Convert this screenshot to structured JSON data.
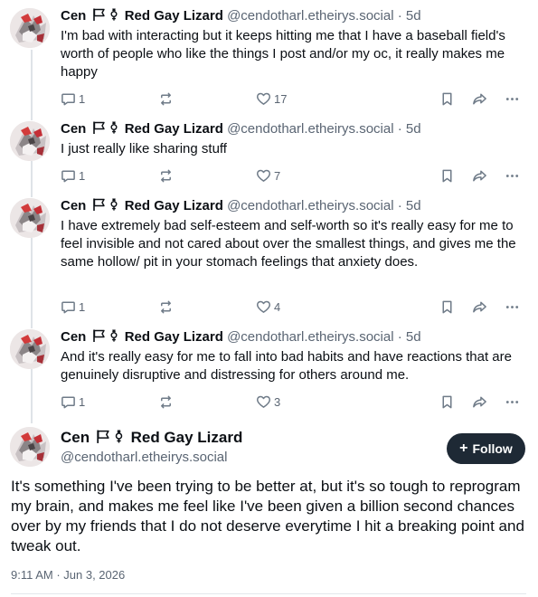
{
  "author": {
    "name": "Cen",
    "name_suffix": "Red Gay Lizard",
    "handle": "@cendotharl.etheirys.social"
  },
  "icons": {
    "flag": "flag-icon",
    "gender": "genderqueer-symbol-icon",
    "reply": "reply-icon",
    "repost": "repost-icon",
    "like": "heart-icon",
    "bookmark": "bookmark-icon",
    "share": "share-icon",
    "more": "more-icon"
  },
  "posts": [
    {
      "time": "5d",
      "text": "I'm bad with interacting but it keeps hitting me that I have a baseball field's worth of people who like the things I post and/or my oc, it really makes me happy",
      "replies": "1",
      "likes": "17"
    },
    {
      "time": "5d",
      "text": "I just really like sharing stuff",
      "replies": "1",
      "likes": "7"
    },
    {
      "time": "5d",
      "text": "I have extremely bad self-esteem and self-worth so it's really easy for me to feel invisible and not cared about over the smallest things, and gives me the same hollow/ pit in your stomach feelings that anxiety does.",
      "replies": "1",
      "likes": "4"
    },
    {
      "time": "5d",
      "text": "And it's really easy for me to fall into bad habits and have reactions that are genuinely disruptive and distressing for others around me.",
      "replies": "1",
      "likes": "3"
    }
  ],
  "main_post": {
    "follow_label": "Follow",
    "text": "It's something I've been trying to be better at, but it's so tough to reprogram my brain, and makes me feel like I've been given a billion second chances over by my friends that I do not deserve everytime I hit a breaking point and tweak out.",
    "timestamp": "9:11 AM · Jun 3, 2026"
  },
  "colors": {
    "text": "#0b0f14",
    "muted": "#5a6573",
    "icon": "#6f7b88",
    "thread_line": "#dfe3e8",
    "follow_bg": "#1e2935"
  }
}
